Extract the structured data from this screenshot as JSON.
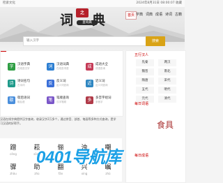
{
  "topbar": {
    "left": "检索文化",
    "right": "2024年8月31日 08:00:07  收藏"
  },
  "logo": {
    "char1": "词",
    "seal": "之",
    "char2": "典",
    "sub": "查询典"
  },
  "nav": [
    "首页",
    "字典",
    "词典",
    "成语",
    "诗词",
    "古籍"
  ],
  "search": {
    "placeholder": "输入汉字",
    "button": "搜索"
  },
  "tools": [
    {
      "name": "汉语字典",
      "sub": "在线查汉字",
      "color": "#2f9e44",
      "glyph": "字"
    },
    {
      "name": "汉语词典",
      "sub": "在线查词语",
      "color": "#2d7fd2",
      "glyph": "词"
    },
    {
      "name": "成语大全",
      "sub": "成语查询",
      "color": "#c53b57",
      "glyph": "成"
    },
    {
      "name": "诗词名句",
      "sub": "古诗词",
      "color": "#1f9a8a",
      "glyph": "诗"
    },
    {
      "name": "反义词",
      "sub": "反义词查询",
      "color": "#3a6fd8",
      "glyph": "反"
    },
    {
      "name": "近义词",
      "sub": "近义词查询",
      "color": "#2e86c1",
      "glyph": "近"
    },
    {
      "name": "歇后语词",
      "sub": "歇后语",
      "color": "#4a8fdc",
      "glyph": "歇"
    },
    {
      "name": "笔顺查询",
      "sub": "汉字笔顺",
      "color": "#7a56c8",
      "glyph": "笔"
    },
    {
      "name": "多音字组词",
      "sub": "多音字",
      "color": "#b03a48",
      "glyph": "多"
    }
  ],
  "sidebar": {
    "wuxing_title": "五行汉人",
    "wuxing": [
      "先秦",
      "两汉",
      "魏晋",
      "南北",
      "隋唐",
      "宋代",
      "五代",
      "明代",
      "元代",
      "清代"
    ],
    "daily_title": "每日词语",
    "daily_word": "食具",
    "daily2_title": "每日成语"
  },
  "description": "汉语在线字典提供汉字查询，收录汉字2万多个，通过拼音、部首、笔画等多种方式查询，是学习汉语的好帮手。",
  "chars": [
    {
      "h": "蹭",
      "p": "cèng"
    },
    {
      "h": "菘",
      "p": "sōng"
    },
    {
      "h": "俪",
      "p": "lì"
    },
    {
      "h": "浊",
      "p": "zhuó"
    },
    {
      "h": "嘲",
      "p": "cháo"
    },
    {
      "h": "骤",
      "p": "zhòu"
    },
    {
      "h": "助",
      "p": "zhù"
    },
    {
      "h": "翻",
      "p": "fān"
    },
    {
      "h": "兴",
      "p": "xìng"
    },
    {
      "h": "瞩",
      "p": "zhǔ"
    }
  ],
  "watermark": "0401导航库"
}
